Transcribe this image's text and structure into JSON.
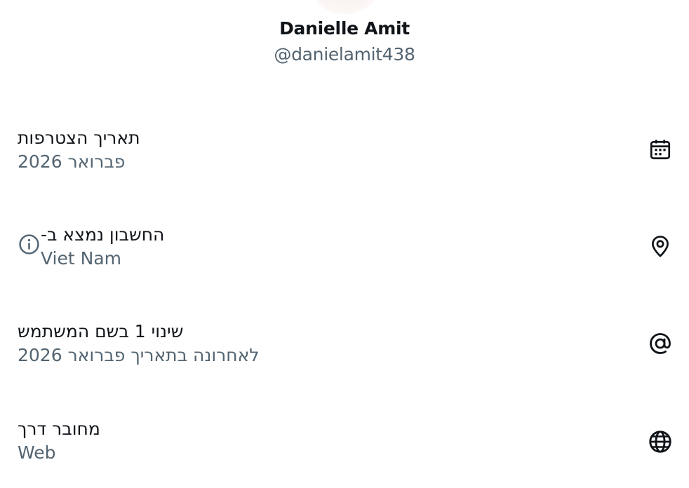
{
  "profile": {
    "display_name": "Danielle Amit",
    "handle": "@danielamit438"
  },
  "rows": [
    {
      "label": "תאריך הצטרפות",
      "value": "פברואר 2026",
      "icon": "calendar-icon"
    },
    {
      "label": "החשבון נמצא ב-",
      "value": "Viet Nam",
      "icon": "location-pin-icon",
      "extra_icon": "info-icon"
    },
    {
      "label": "שינוי 1 בשם המשתמש",
      "value": "לאחרונה בתאריך פברואר 2026",
      "icon": "at-sign-icon"
    },
    {
      "label": "מחובר דרך",
      "value": "Web",
      "icon": "globe-icon"
    }
  ],
  "colors": {
    "primary_text": "#0f1419",
    "secondary_text": "#536471",
    "background": "#ffffff"
  }
}
